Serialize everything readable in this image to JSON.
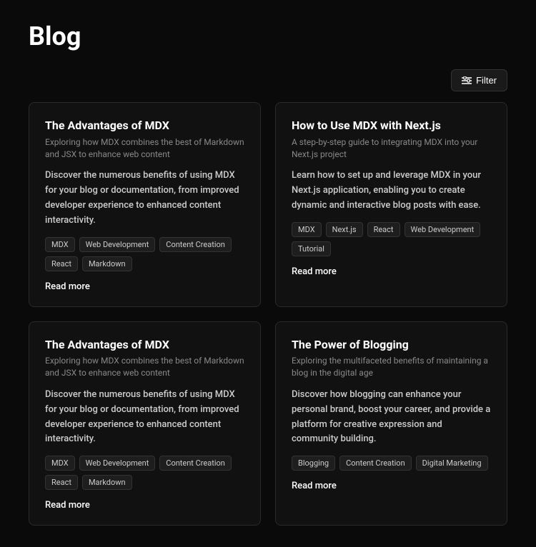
{
  "page": {
    "title": "Blog"
  },
  "toolbar": {
    "filter_label": "Filter"
  },
  "cards": [
    {
      "id": "card-1",
      "title": "The Advantages of MDX",
      "subtitle": "Exploring how MDX combines the best of Markdown and JSX to enhance web content",
      "description": "Discover the numerous benefits of using MDX for your blog or documentation, from improved developer experience to enhanced content interactivity.",
      "tags": [
        "MDX",
        "Web Development",
        "Content Creation",
        "React",
        "Markdown"
      ],
      "read_more": "Read more"
    },
    {
      "id": "card-2",
      "title": "How to Use MDX with Next.js",
      "subtitle": "A step-by-step guide to integrating MDX into your Next.js project",
      "description": "Learn how to set up and leverage MDX in your Next.js application, enabling you to create dynamic and interactive blog posts with ease.",
      "tags": [
        "MDX",
        "Next.js",
        "React",
        "Web Development",
        "Tutorial"
      ],
      "read_more": "Read more"
    },
    {
      "id": "card-3",
      "title": "The Advantages of MDX",
      "subtitle": "Exploring how MDX combines the best of Markdown and JSX to enhance web content",
      "description": "Discover the numerous benefits of using MDX for your blog or documentation, from improved developer experience to enhanced content interactivity.",
      "tags": [
        "MDX",
        "Web Development",
        "Content Creation",
        "React",
        "Markdown"
      ],
      "read_more": "Read more"
    },
    {
      "id": "card-4",
      "title": "The Power of Blogging",
      "subtitle": "Exploring the multifaceted benefits of maintaining a blog in the digital age",
      "description": "Discover how blogging can enhance your personal brand, boost your career, and provide a platform for creative expression and community building.",
      "tags": [
        "Blogging",
        "Content Creation",
        "Digital Marketing"
      ],
      "read_more": "Read more"
    }
  ]
}
